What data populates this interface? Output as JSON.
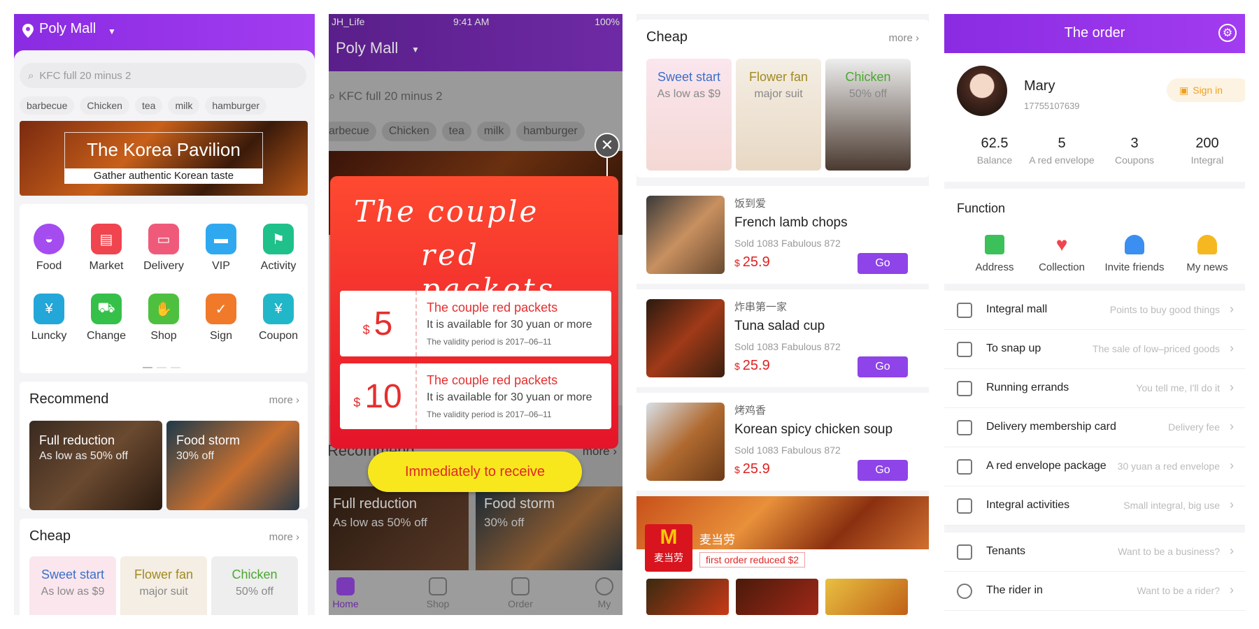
{
  "home": {
    "location": "Poly Mall",
    "search_placeholder": "KFC  full 20 minus 2",
    "chips": [
      "barbecue",
      "Chicken",
      "tea",
      "milk",
      "hamburger"
    ],
    "banner_title": "The Korea Pavilion",
    "banner_subtitle": "Gather authentic Korean taste",
    "grid": [
      {
        "label": "Food",
        "icon": "food-bowl-icon",
        "color": "#a44cf0"
      },
      {
        "label": "Market",
        "icon": "basket-icon",
        "color": "#f0444e"
      },
      {
        "label": "Delivery",
        "icon": "box-icon",
        "color": "#f05a7a"
      },
      {
        "label": "VIP",
        "icon": "card-icon",
        "color": "#2fa8f0"
      },
      {
        "label": "Activity",
        "icon": "flag-icon",
        "color": "#1fc08a"
      },
      {
        "label": "Luncky",
        "icon": "lucky-bag-icon",
        "color": "#23a6d8"
      },
      {
        "label": "Change",
        "icon": "scooter-icon",
        "color": "#35c04a"
      },
      {
        "label": "Shop",
        "icon": "shop-hand-icon",
        "color": "#4ec040"
      },
      {
        "label": "Sign",
        "icon": "calendar-check-icon",
        "color": "#f07a2a"
      },
      {
        "label": "Coupon",
        "icon": "coupon-icon",
        "color": "#22b7c8"
      }
    ],
    "recommend_title": "Recommend",
    "more": "more",
    "recommend": [
      {
        "title": "Full reduction",
        "subtitle": "As low as 50% off"
      },
      {
        "title": "Food storm",
        "subtitle": "30% off"
      }
    ],
    "cheap_title": "Cheap",
    "cheap": [
      {
        "title": "Sweet start",
        "subtitle": "As low as $9",
        "color": "#3a6fc8"
      },
      {
        "title": "Flower fan",
        "subtitle": "major suit",
        "color": "#a08a20"
      },
      {
        "title": "Chicken",
        "subtitle": "50% off",
        "color": "#4aa830"
      }
    ]
  },
  "popup": {
    "status_carrier": "JH_Life",
    "status_time": "9:41 AM",
    "status_battery": "100%",
    "location": "Poly Mall",
    "search_placeholder": "KFC  full 20 minus 2",
    "chips": [
      "arbecue",
      "Chicken",
      "tea",
      "milk",
      "hamburger"
    ],
    "headline_1": "The couple",
    "headline_2": "red packets",
    "coupons": [
      {
        "currency": "$",
        "amount": "5",
        "title": "The couple red packets",
        "condition": "It is available for 30 yuan or more",
        "validity": "The validity period is 2017–06–11"
      },
      {
        "currency": "$",
        "amount": "10",
        "title": "The couple red packets",
        "condition": "It is available for 30 yuan or more",
        "validity": "The validity period is 2017–06–11"
      }
    ],
    "receive_button": "Immediately to receive",
    "bg_recommend": "Recommend",
    "bg_more": "more",
    "bg_tile1_title": "Full reduction",
    "bg_tile1_sub": "As low as 50% off",
    "bg_tile2_title": "Food storm",
    "bg_tile2_sub": "30% off",
    "tabs": [
      "Home",
      "Shop",
      "Order",
      "My"
    ]
  },
  "list": {
    "cheap_title": "Cheap",
    "more": "more",
    "cheap": [
      {
        "title": "Sweet start",
        "subtitle": "As low as $9",
        "color": "#3a6fc8"
      },
      {
        "title": "Flower fan",
        "subtitle": "major suit",
        "color": "#a08a20"
      },
      {
        "title": "Chicken",
        "subtitle": "50% off",
        "color": "#4aa830"
      }
    ],
    "items": [
      {
        "shop": "饭到爱",
        "name": "French lamb chops",
        "sold": "Sold 1083  Fabulous 872",
        "currency": "$",
        "price": "25.9",
        "button": "Go"
      },
      {
        "shop": "炸串第一家",
        "name": "Tuna salad cup",
        "sold": "Sold 1083  Fabulous 872",
        "currency": "$",
        "price": "25.9",
        "button": "Go"
      },
      {
        "shop": "烤鸡香",
        "name": "Korean spicy chicken soup",
        "sold": "Sold 1083  Fabulous 872",
        "currency": "$",
        "price": "25.9",
        "button": "Go"
      }
    ],
    "store_name": "麦当劳",
    "store_logo_text": "麦当劳",
    "store_promo": "first order reduced $2"
  },
  "order": {
    "title": "The order",
    "user_name": "Mary",
    "user_phone": "17755107639",
    "sign_in": "Sign in",
    "stats": [
      {
        "value": "62.5",
        "label": "Balance"
      },
      {
        "value": "5",
        "label": "A red envelope"
      },
      {
        "value": "3",
        "label": "Coupons"
      },
      {
        "value": "200",
        "label": "Integral"
      }
    ],
    "function_title": "Function",
    "functions": [
      {
        "label": "Address",
        "icon": "location-pin-icon",
        "color": "#3cc05a"
      },
      {
        "label": "Collection",
        "icon": "heart-icon",
        "color": "#f0444e"
      },
      {
        "label": "Invite friends",
        "icon": "person-icon",
        "color": "#3a8ff0"
      },
      {
        "label": "My news",
        "icon": "bell-icon",
        "color": "#f5b820"
      }
    ],
    "rows": [
      {
        "label": "Integral mall",
        "value": "Points to buy good things"
      },
      {
        "label": "To snap up",
        "value": "The sale of low–priced goods"
      },
      {
        "label": "Running errands",
        "value": "You tell me, I'll do it"
      },
      {
        "label": "Delivery membership card",
        "value": "Delivery fee"
      },
      {
        "label": "A red envelope package",
        "value": "30 yuan a red envelope"
      },
      {
        "label": "Integral activities",
        "value": "Small integral, big use"
      },
      {
        "label": "Tenants",
        "value": "Want to be a business?"
      },
      {
        "label": "The rider in",
        "value": "Want to be a rider?"
      }
    ]
  }
}
